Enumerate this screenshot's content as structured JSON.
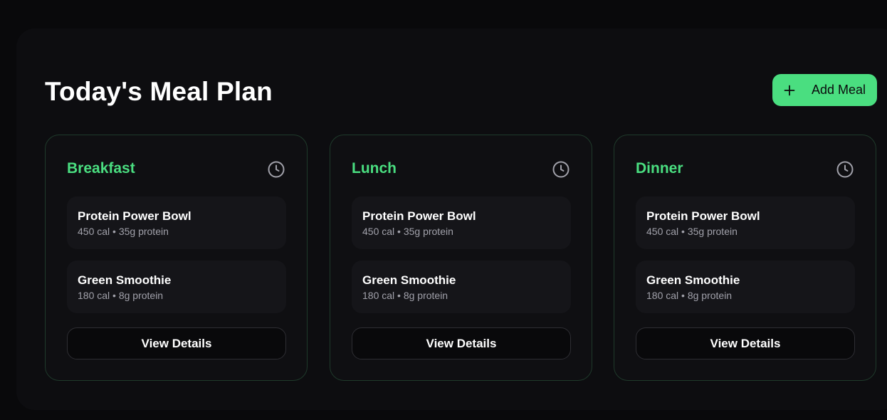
{
  "header": {
    "title": "Today's Meal Plan",
    "add_button_label": "Add Meal"
  },
  "colors": {
    "accent": "#4ade80",
    "background": "#09090b",
    "card_border": "#1f3a2b"
  },
  "meals": [
    {
      "title": "Breakfast",
      "items": [
        {
          "name": "Protein Power Bowl",
          "meta": "450 cal • 35g protein"
        },
        {
          "name": "Green Smoothie",
          "meta": "180 cal • 8g protein"
        }
      ],
      "button_label": "View Details"
    },
    {
      "title": "Lunch",
      "items": [
        {
          "name": "Protein Power Bowl",
          "meta": "450 cal • 35g protein"
        },
        {
          "name": "Green Smoothie",
          "meta": "180 cal • 8g protein"
        }
      ],
      "button_label": "View Details"
    },
    {
      "title": "Dinner",
      "items": [
        {
          "name": "Protein Power Bowl",
          "meta": "450 cal • 35g protein"
        },
        {
          "name": "Green Smoothie",
          "meta": "180 cal • 8g protein"
        }
      ],
      "button_label": "View Details"
    }
  ],
  "icons": {
    "add": "plus-icon",
    "time": "clock-icon"
  }
}
